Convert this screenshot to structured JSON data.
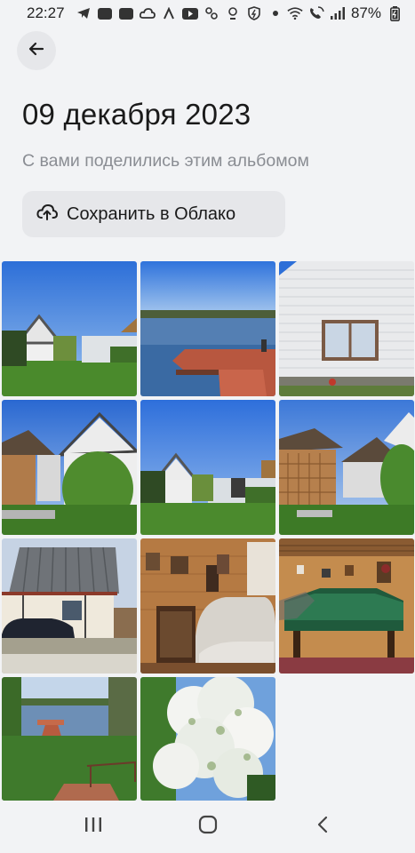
{
  "status_bar": {
    "time": "22:27",
    "battery": "87%",
    "left_icons": [
      "telegram-icon",
      "app-icon",
      "app-icon",
      "cloud-icon",
      "app-icon",
      "youtube-icon",
      "app-icon",
      "app-icon",
      "shield-icon",
      "dot-icon"
    ],
    "right_icons": [
      "wifi-icon",
      "call-icon",
      "signal-icon",
      "battery-icon"
    ]
  },
  "header": {
    "title": "09 декабря 2023",
    "subtitle": "С вами поделились этим альбомом"
  },
  "actions": {
    "save_label": "Сохранить в Облако"
  },
  "photos": [
    {
      "name": "house-garden-photo"
    },
    {
      "name": "lake-pier-photo"
    },
    {
      "name": "house-wall-window-photo"
    },
    {
      "name": "gazebo-house-photo"
    },
    {
      "name": "house-garden-photo-2"
    },
    {
      "name": "gazebo-house-photo-2"
    },
    {
      "name": "carport-house-photo"
    },
    {
      "name": "interior-living-room-photo"
    },
    {
      "name": "billiard-room-photo"
    },
    {
      "name": "lake-path-photo"
    },
    {
      "name": "blossom-tree-photo"
    }
  ]
}
